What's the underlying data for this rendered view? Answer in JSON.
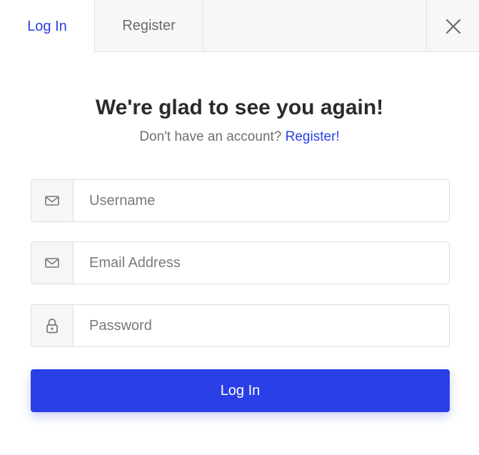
{
  "tabs": {
    "login_label": "Log In",
    "register_label": "Register"
  },
  "heading": "We're glad to see you again!",
  "subline": {
    "text": "Don't have an account?",
    "link": "Register!"
  },
  "fields": {
    "username": {
      "placeholder": "Username",
      "icon": "mail-icon"
    },
    "email": {
      "placeholder": "Email Address",
      "icon": "mail-icon"
    },
    "password": {
      "placeholder": "Password",
      "icon": "lock-icon"
    }
  },
  "submit_label": "Log In",
  "colors": {
    "accent": "#2a3fe6",
    "tabbar_bg": "#f7f7f7",
    "addon_bg": "#f6f6f6"
  }
}
